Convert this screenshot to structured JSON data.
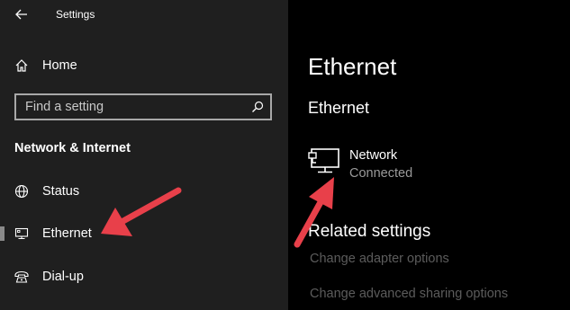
{
  "window": {
    "title": "Settings"
  },
  "sidebar": {
    "home_label": "Home",
    "search": {
      "placeholder": "Find a setting",
      "value": ""
    },
    "section_title": "Network & Internet",
    "items": [
      {
        "label": "Status",
        "icon": "globe-icon"
      },
      {
        "label": "Ethernet",
        "icon": "ethernet-icon",
        "selected": true
      },
      {
        "label": "Dial-up",
        "icon": "dialup-icon"
      }
    ]
  },
  "main": {
    "page_title": "Ethernet",
    "subsection_title": "Ethernet",
    "network": {
      "name": "Network",
      "status": "Connected",
      "icon": "ethernet-network-icon"
    },
    "related": {
      "title": "Related settings",
      "links": [
        "Change adapter options",
        "Change advanced sharing options"
      ]
    }
  },
  "colors": {
    "sidebar_bg": "#1f1f1f",
    "main_bg": "#000000",
    "annotation_arrow": "#e8404a",
    "link_disabled": "#5c5c5c"
  }
}
